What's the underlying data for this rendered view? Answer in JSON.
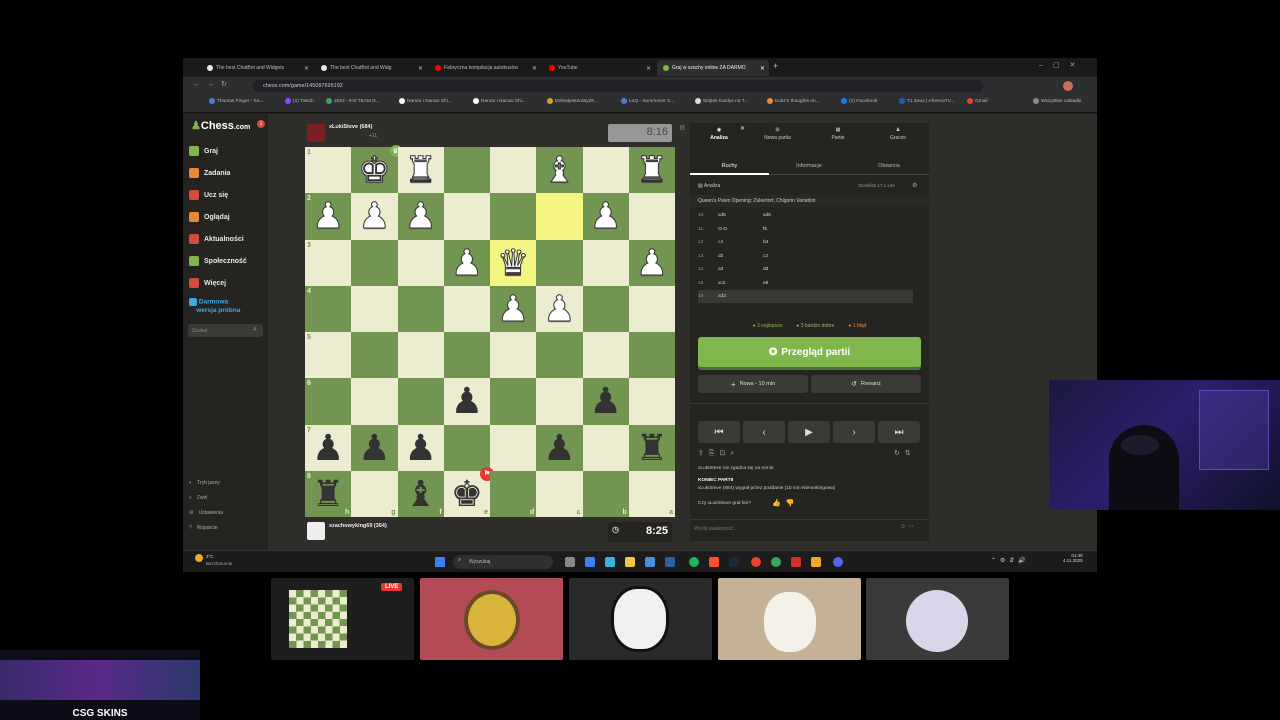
{
  "browser": {
    "tabs": [
      {
        "title": "The best ChatBot and Widgets",
        "color": "#e8e8e8"
      },
      {
        "title": "The best ChatBot and Widg",
        "color": "#e8e8e8"
      },
      {
        "title": "Fabryczna kompilacja autobusów",
        "color": "#ff0000"
      },
      {
        "title": "YouTube",
        "color": "#ff0000"
      },
      {
        "title": "Graj w szachy online ZA DARMO",
        "color": "#81b64c"
      }
    ],
    "url": "chess.com/game/145087695192",
    "bookmarks": [
      "Thomas Finger - Su...",
      "(1) Twitch",
      "2023 - IH3 TEAM D...",
      "Naruto i Naruto Shi...",
      "Naruto i Naruto Shi...",
      "Defeatjesterday29...",
      "LoQ - Summoner S...",
      "Wojtek Kardys na T...",
      "Kubz's thoughts on...",
      "(1) Facebook",
      "T1 Zeus | AfreecaTV...",
      "Gmail",
      "Wszystkie zakładki"
    ]
  },
  "sidebar": {
    "logo_prefix": "Chess",
    "logo_suffix": ".com",
    "badge": "1",
    "items": [
      {
        "label": "Graj",
        "icon": "play-icon",
        "color": "#81b64c"
      },
      {
        "label": "Zadania",
        "icon": "puzzle-icon",
        "color": "#e8883a"
      },
      {
        "label": "Ucz się",
        "icon": "learn-icon",
        "color": "#d34b3d"
      },
      {
        "label": "Oglądaj",
        "icon": "watch-icon",
        "color": "#e8883a"
      },
      {
        "label": "Aktualności",
        "icon": "news-icon",
        "color": "#d34b3d"
      },
      {
        "label": "Społeczność",
        "icon": "community-icon",
        "color": "#81b64c"
      },
      {
        "label": "Więcej",
        "icon": "more-icon",
        "color": "#d34b3d"
      }
    ],
    "premium_line1": "Darmowa",
    "premium_line2": "wersja próbna",
    "search_placeholder": "Szukaj",
    "bottom": [
      "Tryb jasny",
      "Zwiń",
      "Ustawienia",
      "Wsparcie"
    ]
  },
  "game": {
    "top_player": "xLukiSteve (684)",
    "top_player_extra": "+11",
    "top_clock": "8:16",
    "bottom_player": "szachowyking69 (364)",
    "bottom_clock": "8:25",
    "ranks": [
      "1",
      "2",
      "3",
      "4",
      "5",
      "6",
      "7",
      "8"
    ],
    "files": [
      "h",
      "g",
      "f",
      "e",
      "d",
      "c",
      "b",
      "a"
    ],
    "board": [
      [
        ".",
        "K",
        ".",
        "R",
        ".",
        "",
        "B",
        ".",
        "R"
      ],
      [
        "P",
        "P",
        "P",
        "",
        "",
        "",
        "P",
        ""
      ],
      [
        "",
        "",
        "",
        "P",
        "Q",
        "",
        "",
        "P"
      ],
      [
        "",
        "",
        "",
        "",
        "P",
        "P",
        "",
        ""
      ],
      [
        "",
        "",
        "",
        "",
        "",
        "",
        "",
        ""
      ],
      [
        "",
        "",
        "",
        "p",
        "",
        "",
        "p",
        ""
      ],
      [
        "p",
        "p",
        "p",
        "",
        "",
        "p",
        "",
        "r"
      ],
      [
        "r",
        "",
        "b",
        "k",
        "",
        "",
        "",
        ""
      ]
    ]
  },
  "panel": {
    "tabs": [
      "Analiza",
      "Nowa partia",
      "Partie",
      "Gracze"
    ],
    "subtabs": [
      "Ruchy",
      "Informacje",
      "Otwarcia"
    ],
    "analysis_label": "Analiza",
    "engine": "Stockfish 17.1 Lite",
    "opening": "Queen's Pawn Opening: Zukertort, Chigorin Variation",
    "moves": [
      {
        "n": "10.",
        "w": "xd5",
        "b": "xd5"
      },
      {
        "n": "11.",
        "w": "O-O",
        "b": "f5"
      },
      {
        "n": "12.",
        "w": "c4",
        "b": "b4"
      },
      {
        "n": "13.",
        "w": "d2",
        "b": "c2"
      },
      {
        "n": "14.",
        "w": "a3",
        "b": "d3"
      },
      {
        "n": "15.",
        "w": "xc2",
        "b": "e6"
      },
      {
        "n": "16.",
        "w": "xd3",
        "b": ""
      }
    ],
    "stats": [
      "3 najlepsze",
      "3 bardzo dobre",
      "1 błąd"
    ],
    "review_button": "Przegląd partii",
    "new_game": "Nowa - 10 min",
    "rematch": "Rewanż",
    "chat": [
      "xLukiSteve nie zgadza się na remis.",
      "KONIEC PARTII",
      "xLukiSteve (684) wygrał przez poddanie (10 min Nierankingowa)",
      "Czy xLukiSteve grał fair?"
    ],
    "chat_placeholder": "Wyślij wiadomość..."
  },
  "taskbar": {
    "weather_temp": "3°C",
    "weather_desc": "Bezchmurnie",
    "search": "Wyszukaj",
    "time": "01:40",
    "date": "4.11.2025"
  },
  "stream": {
    "live_label": "LIVE",
    "brand": "CSG SKINS"
  }
}
